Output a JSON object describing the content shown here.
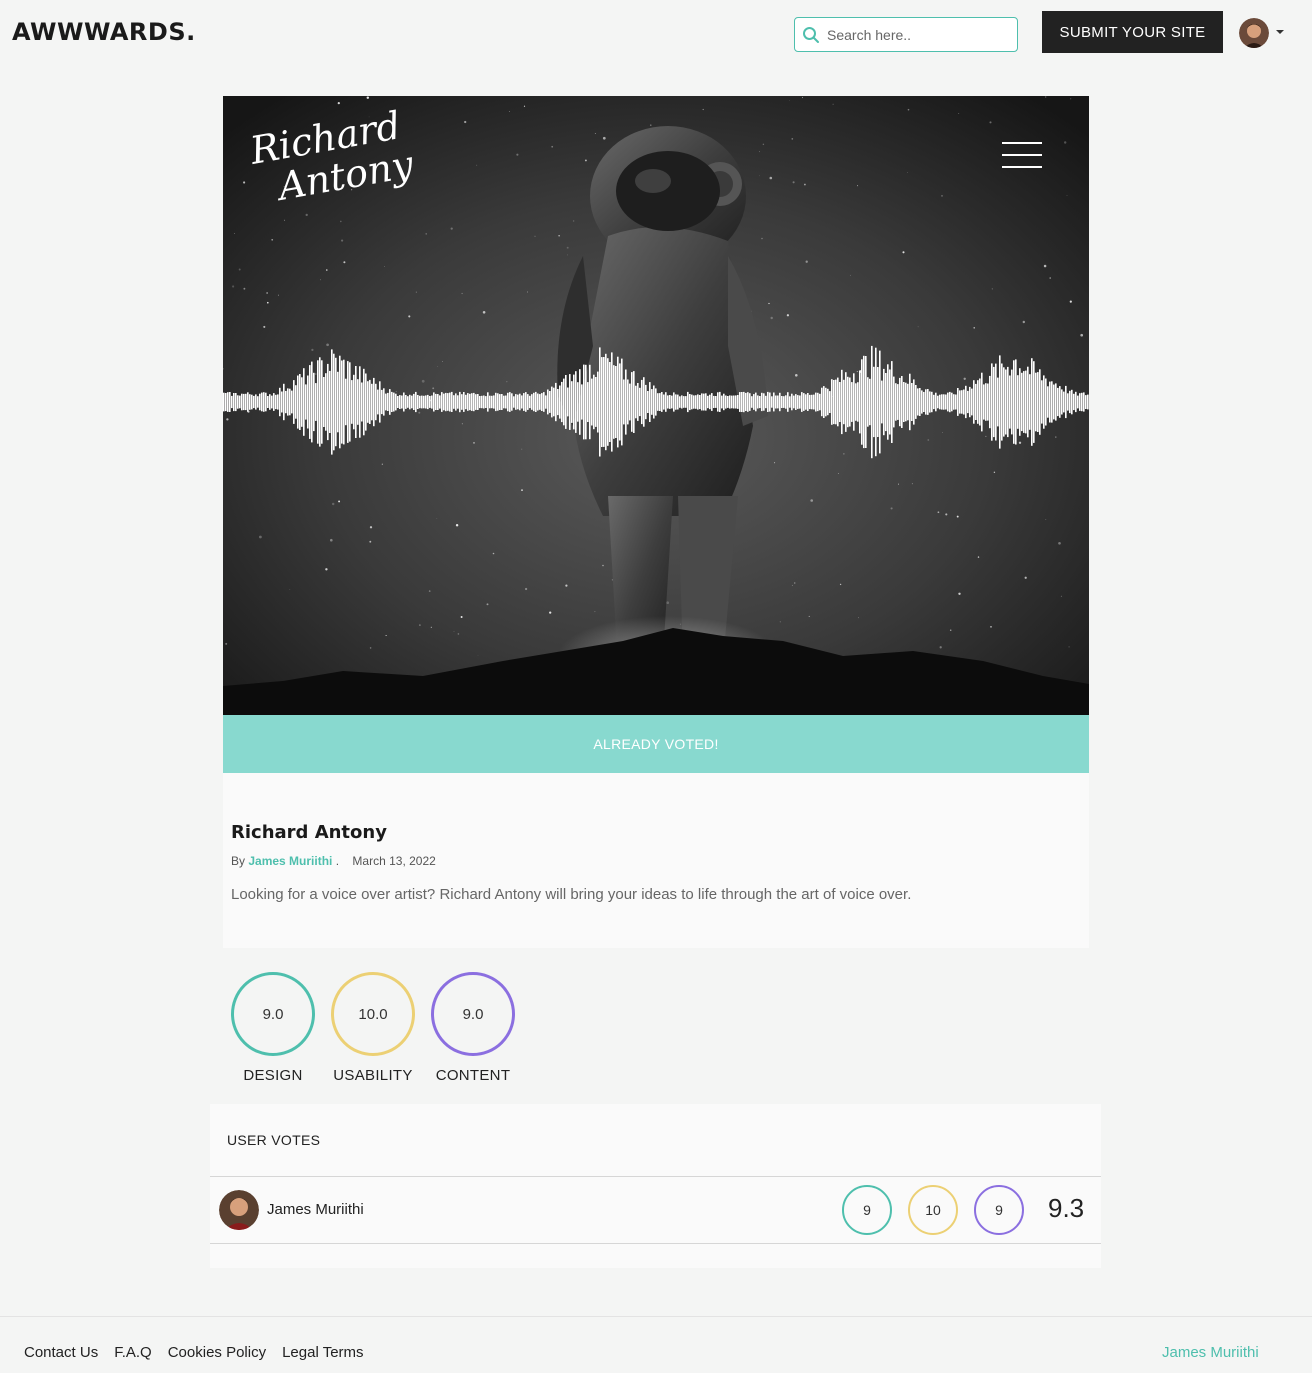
{
  "header": {
    "brand": "AWWWARDS.",
    "search_placeholder": "Search here..",
    "submit_label": "SUBMIT YOUR SITE"
  },
  "hero": {
    "logo_line1": "Richard",
    "logo_line2": "Antony"
  },
  "vote_status": "ALREADY VOTED!",
  "site": {
    "title": "Richard Antony",
    "by_prefix": "By",
    "author": "James Muriithi",
    "author_suffix": ".",
    "date": "March 13, 2022",
    "description": "Looking for a voice over artist? Richard Antony will bring your ideas to life through the art of voice over."
  },
  "scores": [
    {
      "value": "9.0",
      "label": "DESIGN",
      "color": "#4ebfad"
    },
    {
      "value": "10.0",
      "label": "USABILITY",
      "color": "#ecd074"
    },
    {
      "value": "9.0",
      "label": "CONTENT",
      "color": "#8b6fe0"
    }
  ],
  "user_votes": {
    "title": "USER VOTES",
    "rows": [
      {
        "name": "James Muriithi",
        "design": "9",
        "usability": "10",
        "content": "9",
        "average": "9.3"
      }
    ]
  },
  "footer": {
    "links": [
      "Contact Us",
      "F.A.Q",
      "Cookies Policy",
      "Legal Terms"
    ],
    "credit": "James Muriithi"
  },
  "colors": {
    "accent": "#4ebfad",
    "vote_bar": "#88d9cf",
    "design": "#4ebfad",
    "usability": "#ecd074",
    "content": "#8b6fe0"
  },
  "icons": [
    "search-icon",
    "hamburger-menu-icon",
    "chevron-down-icon"
  ]
}
